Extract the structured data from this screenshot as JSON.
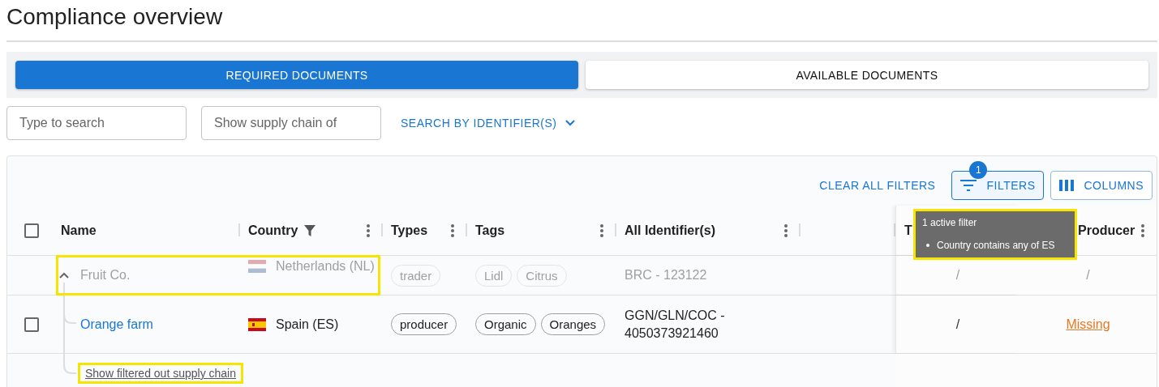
{
  "page_title": "Compliance overview",
  "tabs": [
    {
      "label": "REQUIRED DOCUMENTS",
      "selected": true
    },
    {
      "label": "AVAILABLE DOCUMENTS",
      "selected": false
    }
  ],
  "search": {
    "placeholder": "Type to search"
  },
  "supply_chain_search": {
    "placeholder": "Show supply chain of"
  },
  "identifier_search": {
    "label": "SEARCH BY IDENTIFIER(S)"
  },
  "toolbar": {
    "clear_label": "CLEAR ALL FILTERS",
    "filters_label": "FILTERS",
    "filters_count": "1",
    "columns_label": "COLUMNS"
  },
  "columns": [
    {
      "label": "Name",
      "menu": false,
      "filtered": false
    },
    {
      "label": "Country",
      "menu": true,
      "filtered": true
    },
    {
      "label": "Types",
      "menu": true,
      "filtered": false
    },
    {
      "label": "Tags",
      "menu": true,
      "filtered": false
    },
    {
      "label": "All Identifier(s)",
      "menu": true,
      "filtered": false
    },
    {
      "label": "T",
      "menu": false,
      "filtered": false
    },
    {
      "label": "Producer",
      "menu": true,
      "filtered": false
    }
  ],
  "rows": [
    {
      "kind": "parent",
      "dimmed": true,
      "expanded": true,
      "highlighted": true,
      "name": "Fruit Co.",
      "flag": {
        "kind": "nl"
      },
      "country": "Netherlands (NL)",
      "types": [
        "trader"
      ],
      "tags": [
        "Lidl",
        "Citrus"
      ],
      "identifier": "BRC - 123122",
      "trader": "/",
      "producer": {
        "kind": "plain",
        "text": "/"
      }
    },
    {
      "kind": "child",
      "dimmed": false,
      "checked": false,
      "highlighted": false,
      "name": "Orange farm",
      "flag": {
        "kind": "es"
      },
      "country": "Spain (ES)",
      "types": [
        "producer"
      ],
      "tags": [
        "Organic",
        "Oranges"
      ],
      "identifier": "GGN/GLN/COC - 4050373921460",
      "trader": "/",
      "producer": {
        "kind": "link",
        "text": "Missing"
      }
    },
    {
      "kind": "more",
      "highlighted": true,
      "name": "Show filtered out supply chain"
    }
  ],
  "select_all": {
    "checked": false
  },
  "tooltip": {
    "title": "1 active filter",
    "items": [
      "Country contains any of ES"
    ],
    "highlighted": true
  }
}
